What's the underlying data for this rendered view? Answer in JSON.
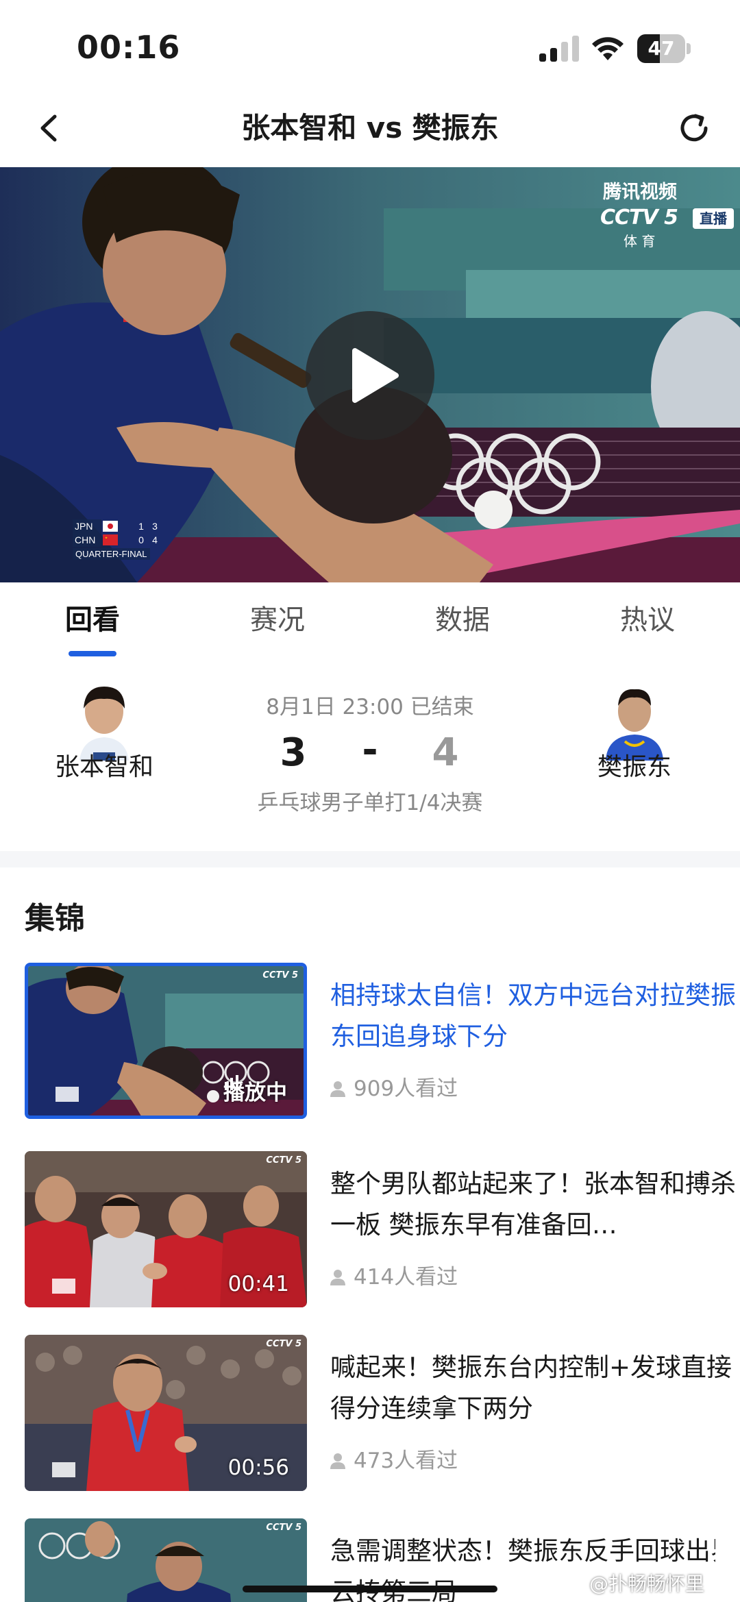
{
  "status_bar": {
    "time": "00:16",
    "battery_level": "47",
    "battery_fraction": 0.47
  },
  "nav": {
    "title": "张本智和 vs 樊振东",
    "back_icon": "chevron-left-icon",
    "refresh_icon": "refresh-icon"
  },
  "video": {
    "watermark_tencent": "腾讯视频",
    "channel": "CCTV 5",
    "live_badge": "直播",
    "channel_sub": "体 育",
    "overlay": {
      "team1": "JPN",
      "team1_score1": "1",
      "team1_score2": "3",
      "team2": "CHN",
      "team2_score1": "0",
      "team2_score2": "4",
      "round": "QUARTER-FINAL"
    }
  },
  "tabs": [
    {
      "label": "回看",
      "active": true
    },
    {
      "label": "赛况",
      "active": false
    },
    {
      "label": "数据",
      "active": false
    },
    {
      "label": "热议",
      "active": false
    }
  ],
  "match": {
    "home_player": "张本智和",
    "away_player": "樊振东",
    "date_status": "8月1日 23:00 已结束",
    "home_score": "3",
    "separator": "-",
    "away_score": "4",
    "event": "乒乓球男子单打1/4决赛"
  },
  "highlights": {
    "section_title": "集锦",
    "playing_label": "播放中",
    "items": [
      {
        "title": "相持球太自信！双方中远台对拉樊振东回追身球下分",
        "views": "909人看过",
        "duration": "",
        "playing": true
      },
      {
        "title": "整个男队都站起来了！张本智和搏杀一板 樊振东早有准备回…",
        "views": "414人看过",
        "duration": "00:41",
        "playing": false
      },
      {
        "title": "喊起来！樊振东台内控制+发球直接得分连续拿下两分",
        "views": "473人看过",
        "duration": "00:56",
        "playing": false
      },
      {
        "title": "急需调整状态！樊振东反手回球出界云抟第三局",
        "views": "",
        "duration": "",
        "playing": false
      }
    ]
  },
  "watermark": "@扑畅畅怀里",
  "colors": {
    "accent": "#1f5fe0",
    "text": "#1a1a1a",
    "muted": "#888888"
  }
}
